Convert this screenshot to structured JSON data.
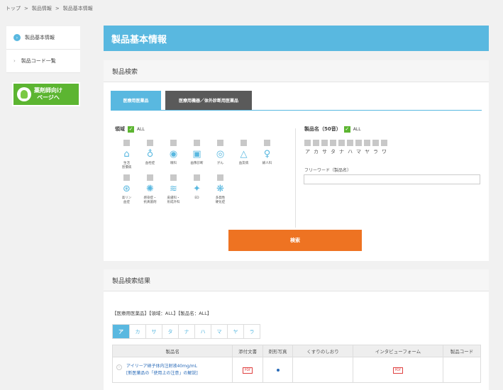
{
  "breadcrumb": [
    "トップ",
    ">",
    "製品情報",
    ">",
    "製品基本情報"
  ],
  "sidebar": {
    "items": [
      {
        "label": "製品基本情報",
        "icon": "check-circle-icon"
      },
      {
        "label": "製品コード一覧",
        "icon": "arrow-right-icon"
      }
    ],
    "banner": {
      "line1": "薬剤師向け",
      "line2": "ページへ"
    }
  },
  "header": {
    "title": "製品基本情報"
  },
  "search": {
    "title": "製品検索",
    "tabs": [
      {
        "label": "医療用医薬品",
        "active": true
      },
      {
        "label": "医療用機器／体外診断用医薬品",
        "active": false
      }
    ],
    "field_label": "領域",
    "field_all": "ALL",
    "fields": [
      {
        "label": "生活\n習慣病",
        "icon": "house-icon",
        "glyph": "⌂"
      },
      {
        "label": "血栓症",
        "icon": "drop-icon",
        "glyph": "♁"
      },
      {
        "label": "眼科",
        "icon": "eye-icon",
        "glyph": "◉"
      },
      {
        "label": "画像診断",
        "icon": "scan-icon",
        "glyph": "▣"
      },
      {
        "label": "がん",
        "icon": "cell-icon",
        "glyph": "◎"
      },
      {
        "label": "血友病",
        "icon": "blood-drop-icon",
        "glyph": "△"
      },
      {
        "label": "婦人科",
        "icon": "uterus-icon",
        "glyph": "♀"
      },
      {
        "label": "高リン\n血症",
        "icon": "kidney-icon",
        "glyph": "⊛"
      },
      {
        "label": "感染症・\n抗真菌剤",
        "icon": "virus-icon",
        "glyph": "✺"
      },
      {
        "label": "皮膚科・\n形成外科",
        "icon": "skin-icon",
        "glyph": "≋"
      },
      {
        "label": "ED",
        "icon": "pill-icon",
        "glyph": "✦"
      },
      {
        "label": "多発性\n硬化症",
        "icon": "nerve-icon",
        "glyph": "❋"
      }
    ],
    "name_label": "製品名（50音）",
    "name_all": "ALL",
    "kana": [
      "ア",
      "カ",
      "サ",
      "タ",
      "ナ",
      "ハ",
      "マ",
      "ヤ",
      "ラ",
      "ワ"
    ],
    "free_word_label": "フリーワード（製品名）",
    "free_word_value": "",
    "button_label": "検索"
  },
  "results": {
    "title": "製品検索結果",
    "condition": "【医療用医薬品】【領域：ALL】【製品名：ALL】",
    "kana_tabs": [
      {
        "label": "ア",
        "active": true
      },
      {
        "label": "カ",
        "active": false
      },
      {
        "label": "サ",
        "active": false
      },
      {
        "label": "タ",
        "active": false
      },
      {
        "label": "ナ",
        "active": false
      },
      {
        "label": "ハ",
        "active": false
      },
      {
        "label": "マ",
        "active": false
      },
      {
        "label": "ヤ",
        "active": false
      },
      {
        "label": "ラ",
        "active": false
      }
    ],
    "columns": [
      "製品名",
      "添付文書",
      "剤形写真",
      "くすりのしおり",
      "インタビューフォーム",
      "製品コード"
    ],
    "rows": [
      {
        "name_line1": "アイリーア硝子体内注射液40mg/mL",
        "name_line2": "[新医薬品の「使用上の注意」の解説]",
        "package_insert": "PDF",
        "interview_form": "PDF"
      }
    ]
  },
  "colors": {
    "accent": "#59b8e0",
    "brand_green": "#5cb531",
    "button": "#ee7322"
  }
}
